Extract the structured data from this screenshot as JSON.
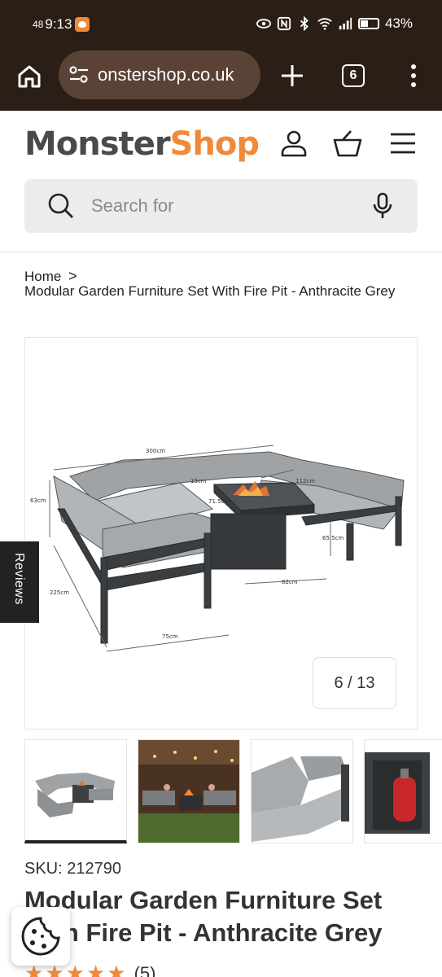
{
  "status_bar": {
    "small_indicator": "48",
    "time": "9:13",
    "battery_percent": "43%"
  },
  "browser": {
    "url": "onstershop.co.uk",
    "tab_count": "6"
  },
  "site": {
    "logo_part1": "Monster",
    "logo_part2": "Shop",
    "search_placeholder": "Search for",
    "brand_color": "#f08a3a"
  },
  "breadcrumb": {
    "home": "Home",
    "separator": ">",
    "current": "Modular Garden Furniture Set With Fire Pit - Anthracite Grey"
  },
  "gallery": {
    "counter": "6 / 13",
    "labels": {
      "width_top": "300cm",
      "height_left": "63cm",
      "depth_left": "225cm",
      "seat_depth": "75cm",
      "table_top_small": "15cm",
      "table_width": "112cm",
      "table_height": "71.5cm",
      "table_depth": "82cm",
      "side_height": "65.5cm"
    }
  },
  "reviews_tab": "Reviews",
  "product": {
    "sku": "SKU: 212790",
    "title": "Modular Garden Furniture Set With Fire Pit - Anthracite Grey",
    "rating_stars": 5,
    "review_count": "(5)"
  },
  "icons": {
    "home": "home-icon",
    "site_settings": "tune-icon",
    "new_tab": "plus-icon",
    "tabs": "tabs-icon",
    "more": "more-vert-icon",
    "account": "account-icon",
    "basket": "basket-icon",
    "menu": "hamburger-icon",
    "search": "search-icon",
    "mic": "mic-icon",
    "cookie": "cookie-icon"
  }
}
